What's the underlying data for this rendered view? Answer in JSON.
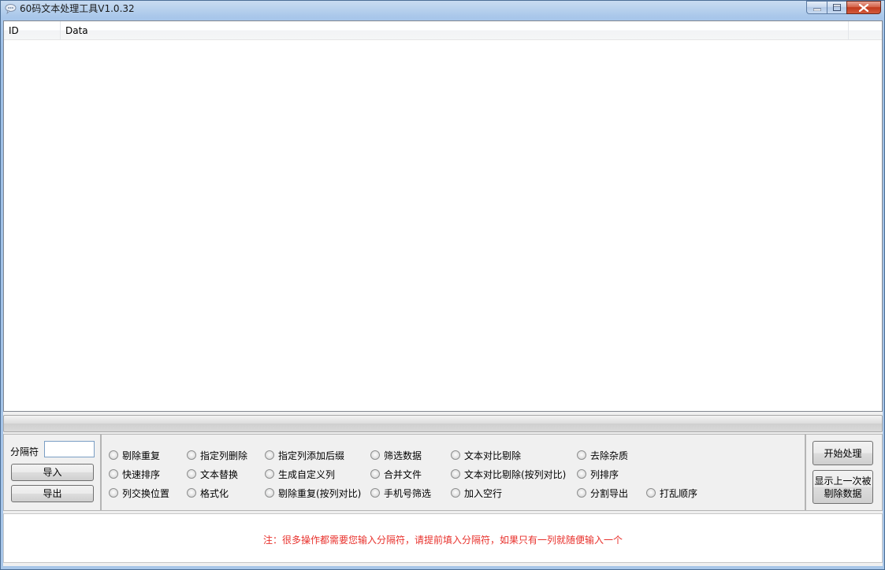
{
  "window": {
    "title": "60码文本处理工具V1.0.32"
  },
  "table": {
    "columns": [
      "ID",
      "Data",
      ""
    ],
    "rows": []
  },
  "left_panel": {
    "separator_label": "分隔符",
    "separator_value": "",
    "import_label": "导入",
    "export_label": "导出"
  },
  "options": {
    "row1": [
      "剔除重复",
      "指定列删除",
      "指定列添加后缀",
      "筛选数据",
      "文本对比剔除",
      "去除杂质"
    ],
    "row2": [
      "快速排序",
      "文本替换",
      "生成自定义列",
      "合并文件",
      "文本对比剔除(按列对比)",
      "列排序"
    ],
    "row3": [
      "列交换位置",
      "格式化",
      "剔除重复(按列对比)",
      "手机号筛选",
      "加入空行",
      "分割导出",
      "打乱顺序"
    ]
  },
  "right_panel": {
    "start_label": "开始处理",
    "show_removed_label": "显示上一次被剔除数据"
  },
  "note": {
    "text": "注：很多操作都需要您输入分隔符，请提前填入分隔符，如果只有一列就随便输入一个",
    "color": "#e8312c"
  }
}
